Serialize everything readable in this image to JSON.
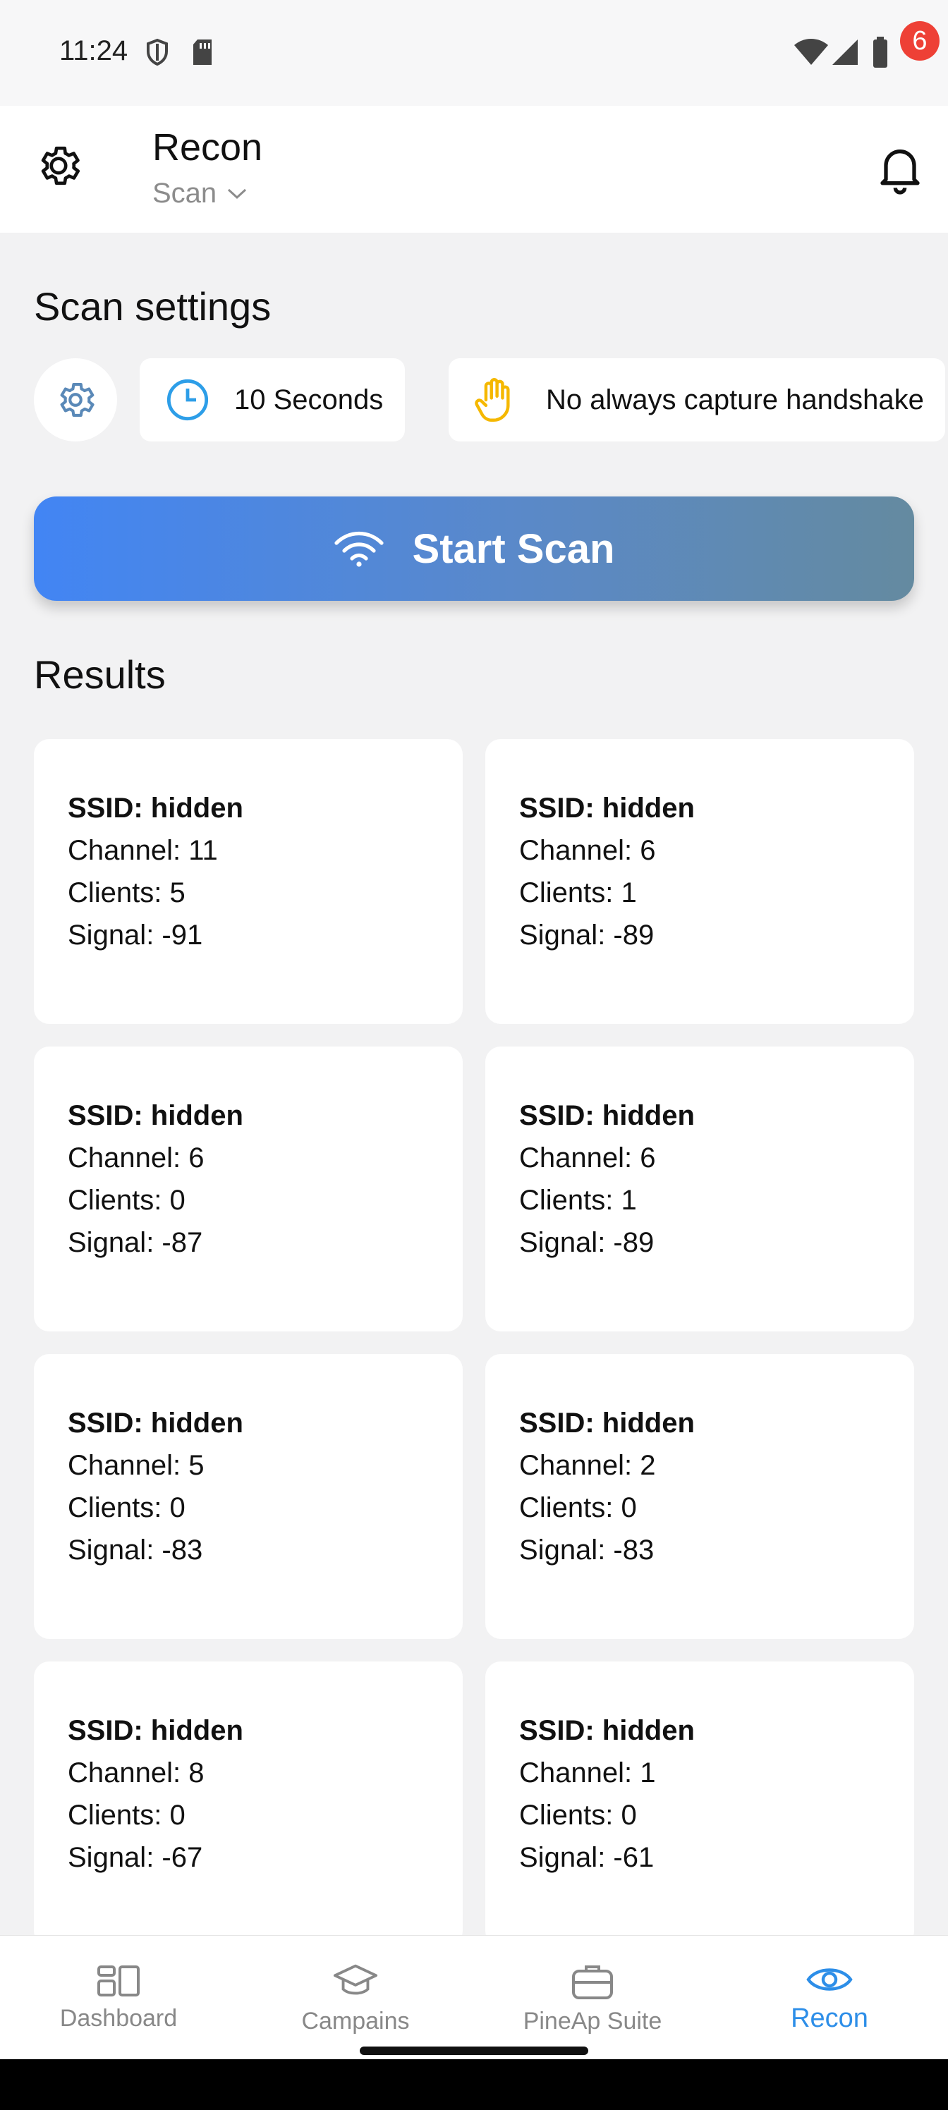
{
  "status_bar": {
    "time": "11:24"
  },
  "header": {
    "title": "Recon",
    "subtitle": "Scan",
    "notification_count": "6"
  },
  "scan_settings": {
    "title": "Scan settings",
    "duration_label": "10 Seconds",
    "handshake_label": "No always capture handshake",
    "start_button": "Start Scan"
  },
  "results": {
    "title": "Results",
    "items": [
      {
        "ssid": "SSID: hidden",
        "channel": "Channel: 11",
        "clients": "Clients: 5",
        "signal": "Signal: -91"
      },
      {
        "ssid": "SSID: hidden",
        "channel": "Channel: 6",
        "clients": "Clients: 1",
        "signal": "Signal: -89"
      },
      {
        "ssid": "SSID: hidden",
        "channel": "Channel: 6",
        "clients": "Clients: 0",
        "signal": "Signal: -87"
      },
      {
        "ssid": "SSID: hidden",
        "channel": "Channel: 6",
        "clients": "Clients: 1",
        "signal": "Signal: -89"
      },
      {
        "ssid": "SSID: hidden",
        "channel": "Channel: 5",
        "clients": "Clients: 0",
        "signal": "Signal: -83"
      },
      {
        "ssid": "SSID: hidden",
        "channel": "Channel: 2",
        "clients": "Clients: 0",
        "signal": "Signal: -83"
      },
      {
        "ssid": "SSID: hidden",
        "channel": "Channel: 8",
        "clients": "Clients: 0",
        "signal": "Signal: -67"
      },
      {
        "ssid": "SSID: hidden",
        "channel": "Channel: 1",
        "clients": "Clients: 0",
        "signal": "Signal: -61"
      }
    ]
  },
  "bottom_nav": {
    "items": [
      {
        "label": "Dashboard",
        "icon": "dashboard-icon"
      },
      {
        "label": "Campains",
        "icon": "graduation-cap-icon"
      },
      {
        "label": "PineAp Suite",
        "icon": "briefcase-icon"
      },
      {
        "label": "Recon",
        "icon": "eye-icon",
        "active": true
      }
    ]
  },
  "colors": {
    "accent": "#4285f4",
    "nav_active": "#2d8ee8",
    "badge": "#ee4036",
    "hand_icon": "#f5b800",
    "clock_icon": "#2d9ee8"
  }
}
